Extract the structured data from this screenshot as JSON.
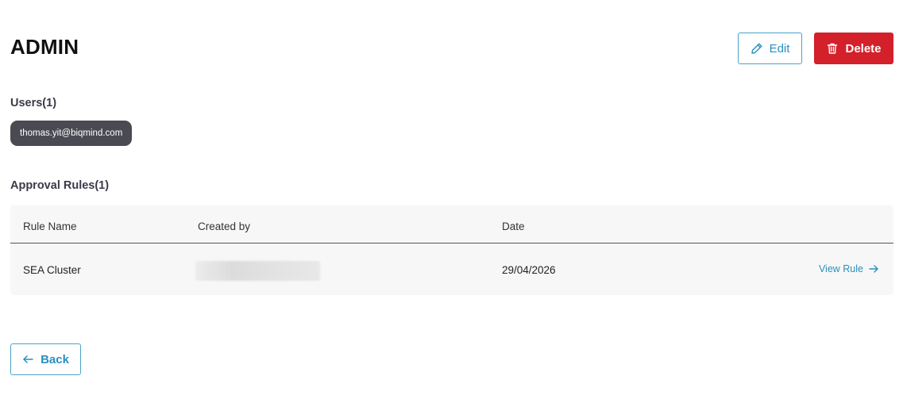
{
  "page": {
    "title": "ADMIN"
  },
  "actions": {
    "edit_label": "Edit",
    "delete_label": "Delete",
    "back_label": "Back"
  },
  "users": {
    "label": "Users(1)",
    "items": [
      "thomas.yit@biqmind.com"
    ]
  },
  "approval_rules": {
    "label": "Approval Rules(1)",
    "columns": [
      "Rule Name",
      "Created by",
      "Date"
    ],
    "rows": [
      {
        "rule_name": "SEA Cluster",
        "created_by": "",
        "date": "29/04/2026",
        "action_label": "View Rule"
      }
    ]
  },
  "colors": {
    "accent": "#2a8fbf",
    "danger": "#d3202a",
    "chip_bg": "#4a4a52"
  },
  "icons": {
    "edit": "pencil-icon",
    "delete": "trash-icon",
    "back": "arrow-left-icon",
    "view": "arrow-right-icon"
  }
}
